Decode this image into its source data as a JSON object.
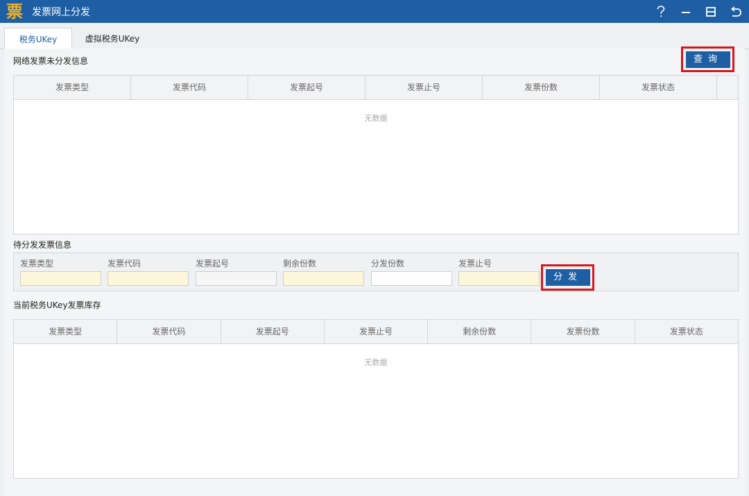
{
  "window": {
    "icon_char": "票",
    "title": "发票网上分发"
  },
  "tabs": [
    {
      "label": "税务UKey"
    },
    {
      "label": "虚拟税务UKey"
    }
  ],
  "section1": {
    "title": "网络发票未分发信息",
    "query_button": "查询",
    "columns": [
      "发票类型",
      "发票代码",
      "发票起号",
      "发票止号",
      "发票份数",
      "发票状态"
    ],
    "empty_text": "无数据"
  },
  "section2": {
    "title": "待分发发票信息",
    "fields": [
      {
        "label": "发票类型",
        "value": ""
      },
      {
        "label": "发票代码",
        "value": ""
      },
      {
        "label": "发票起号",
        "value": ""
      },
      {
        "label": "剩余份数",
        "value": ""
      },
      {
        "label": "分发份数",
        "value": ""
      },
      {
        "label": "发票止号",
        "value": ""
      }
    ],
    "distribute_button": "分发"
  },
  "section3": {
    "title": "当前税务UKey发票库存",
    "columns": [
      "发票类型",
      "发票代码",
      "发票起号",
      "发票止号",
      "剩余份数",
      "发票份数",
      "发票状态"
    ],
    "empty_text": "无数据"
  },
  "colors": {
    "titlebar": "#1e5fa3",
    "highlight": "#d9141b",
    "input_yellow": "#fdf6d8"
  }
}
